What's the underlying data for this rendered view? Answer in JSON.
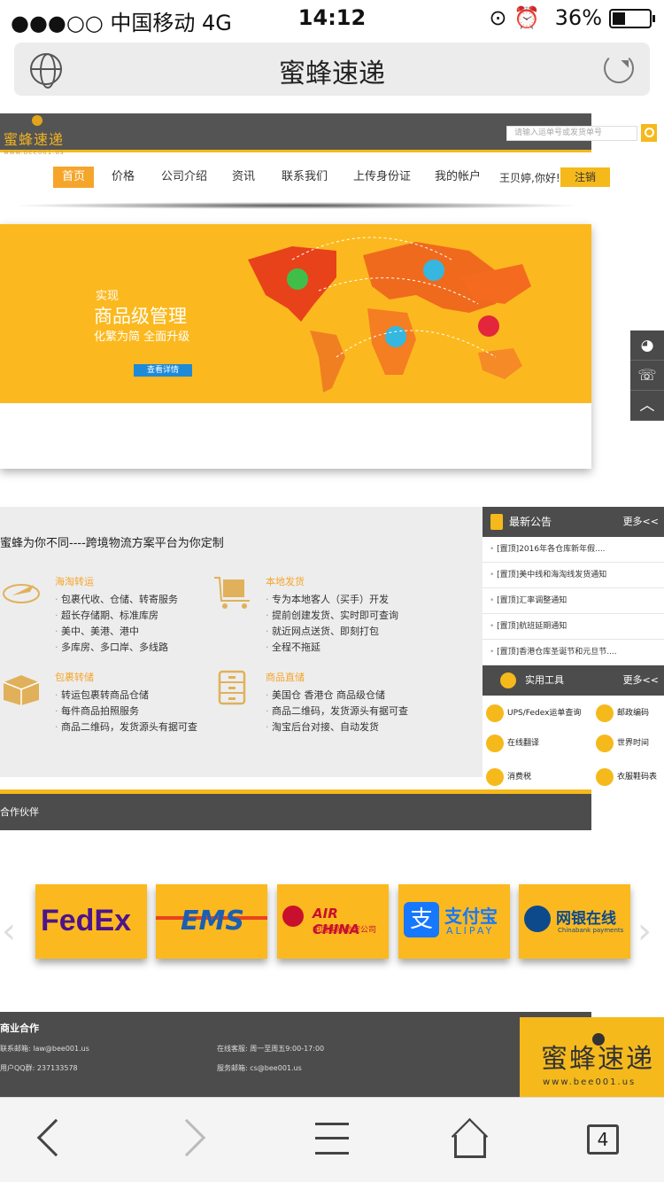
{
  "status_bar": {
    "carrier": "●●●○○ 中国移动  4G",
    "time": "14:12",
    "battery": "36%",
    "battery_level": 0.36
  },
  "browser": {
    "page_title": "蜜蜂速递",
    "tabs_count": "4"
  },
  "site": {
    "logo_text": "蜜蜂速递",
    "logo_url_text": "www.bee001.us",
    "search_placeholder": "请输入运单号或发货单号",
    "nav": [
      "首页",
      "价格",
      "公司介绍",
      "资讯",
      "联系我们",
      "上传身份证",
      "我的帐户"
    ],
    "user_greeting": "王贝婷,你好!",
    "logout_label": "注销"
  },
  "banner": {
    "small": "实现",
    "big": "商品级管理",
    "sub": "化繁为简  全面升级",
    "button": "查看详情"
  },
  "features": {
    "title": "蜜蜂为你不同----跨境物流方案平台为你定制",
    "blocks": [
      {
        "head": "海淘转运",
        "items": [
          "包裹代收、仓储、转寄服务",
          "超长存储期、标准库房",
          "美中、美港、港中",
          "多库房、多口岸、多线路"
        ]
      },
      {
        "head": "本地发货",
        "items": [
          "专为本地客人（买手）开发",
          "提前创建发货、实时即可查询",
          "就近网点送货、即刻打包",
          "全程不拖延"
        ]
      },
      {
        "head": "包裹转储",
        "items": [
          "转运包裹转商品仓储",
          "每件商品拍照服务",
          "商品二维码，发货源头有据可查"
        ]
      },
      {
        "head": "商品直储",
        "items": [
          "美国仓 香港仓 商品级仓储",
          "商品二维码，发货源头有据可查",
          "淘宝后台对接、自动发货"
        ]
      }
    ]
  },
  "news": {
    "title": "最新公告",
    "more": "更多<<",
    "items": [
      "[置顶]2016年各仓库新年假....",
      "[置顶]美中线和海淘线发货通知",
      "[置顶]汇率调整通知",
      "[置顶]航班延期通知",
      "[置顶]香港仓库圣诞节和元旦节...."
    ]
  },
  "tools": {
    "title": "实用工具",
    "more": "更多<<",
    "items": [
      "UPS/Fedex运单查询",
      "邮政编码",
      "在线翻译",
      "世界时间",
      "消费税",
      "衣服鞋码表"
    ]
  },
  "partners": {
    "title": "合作伙伴",
    "logos": [
      {
        "text": "FedEx",
        "color": "#4d148c"
      },
      {
        "text": "EMS",
        "color": "#1a5fb4"
      },
      {
        "text": "AIR CHINA",
        "sub": "中国国际航空公司",
        "color": "#c8102e"
      },
      {
        "text": "支付宝",
        "sub": "ALIPAY",
        "color": "#1677ff"
      },
      {
        "text": "网银在线",
        "sub": "Chinabank payments",
        "color": "#0d4a8c"
      }
    ]
  },
  "footer": {
    "title": "商业合作",
    "email_label": "联系邮箱:  law@bee001.us",
    "qq_label": "用户QQ群:  237133578",
    "hours_label": "在线客服:  周一至周五9:00-17:00",
    "service_label": "服务邮箱:  cs@bee001.us",
    "logo_text": "蜜蜂速递",
    "logo_url": "www.bee001.us"
  },
  "colors": {
    "brand_yellow": "#f5b91c",
    "dark_gray": "#4c4c4c",
    "nav_active": "#f5a52a"
  }
}
